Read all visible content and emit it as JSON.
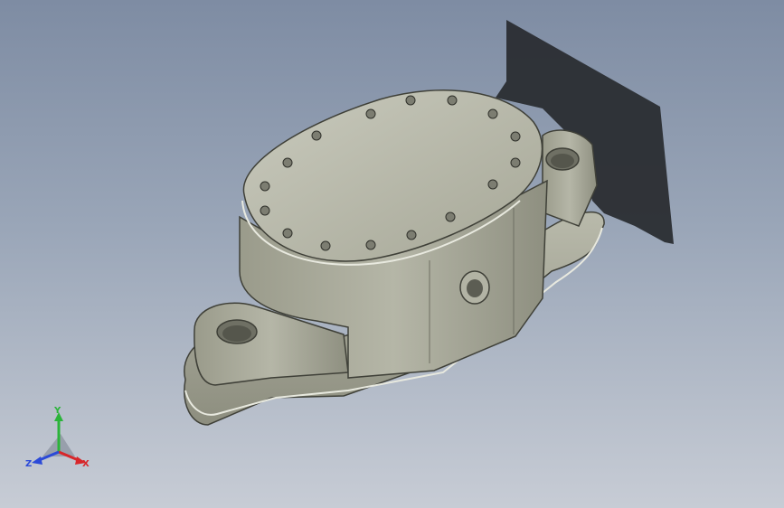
{
  "viewport": {
    "background_top": "#7e8ca3",
    "background_bottom": "#c7ccd5"
  },
  "model": {
    "body_color": "#a9aa9b",
    "shadow_color": "#2a2d32",
    "cover_bolt_count": 16
  },
  "triad": {
    "x_label": "X",
    "y_label": "Y",
    "z_label": "Z",
    "x_color": "#d8262a",
    "y_color": "#2bb43a",
    "z_color": "#2b4ad8"
  }
}
